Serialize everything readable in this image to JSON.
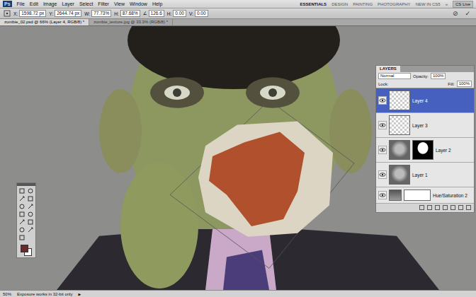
{
  "menu_bar": {
    "logo": "Ps",
    "items": [
      "File",
      "Edit",
      "Image",
      "Layer",
      "Select",
      "Filter",
      "View",
      "Window",
      "Help"
    ],
    "workspaces": [
      {
        "label": "ESSENTIALS",
        "selected": true
      },
      {
        "label": "DESIGN",
        "selected": false
      },
      {
        "label": "PAINTING",
        "selected": false
      },
      {
        "label": "PHOTOGRAPHY",
        "selected": false
      },
      {
        "label": "NEW IN CS5",
        "selected": false
      }
    ],
    "more": "»",
    "cs_live": "CS Live"
  },
  "options_bar": {
    "fields": [
      {
        "label": "X:",
        "value": "1598.72 px"
      },
      {
        "label": "Y:",
        "value": "2644.74 px"
      },
      {
        "label": "W:",
        "value": "77.73%"
      },
      {
        "label": "H:",
        "value": "87.68%"
      },
      {
        "label": "∠",
        "value": "126.6"
      },
      {
        "label": "H:",
        "value": "0.00"
      },
      {
        "label": "V:",
        "value": "0.00"
      }
    ],
    "buttons": [
      "⊘",
      "✓"
    ]
  },
  "document_tabs": [
    {
      "label": "zombie_02.psd @ 66% (Layer 4, RGB/8) *",
      "selected": true
    },
    {
      "label": "zombie_texture.jpg @ 33.3% (RGB/8) *",
      "selected": false
    }
  ],
  "layers_panel": {
    "tabs": [
      {
        "label": "LAYERS",
        "selected": true
      }
    ],
    "blend_mode": "Normal",
    "opacity_label": "Opacity:",
    "opacity": "100%",
    "lock_label": "Lock:",
    "fill_label": "Fill:",
    "fill": "100%",
    "layers": [
      {
        "name": "Layer 4",
        "kind": "pixel",
        "visible": true,
        "selected": true,
        "has_mask": false
      },
      {
        "name": "Layer 3",
        "kind": "pixel",
        "visible": true,
        "selected": false,
        "has_mask": false
      },
      {
        "name": "Layer 2",
        "kind": "photo",
        "visible": true,
        "selected": false,
        "has_mask": true
      },
      {
        "name": "Layer 1",
        "kind": "photo",
        "visible": true,
        "selected": false,
        "has_mask": false
      },
      {
        "name": "Hue/Saturation 2",
        "kind": "adjustment",
        "visible": true,
        "selected": false,
        "has_mask": true
      }
    ]
  },
  "status_bar": {
    "zoom": "50%",
    "message": "Exposure works in 32-bit only",
    "arrow": "▶"
  }
}
